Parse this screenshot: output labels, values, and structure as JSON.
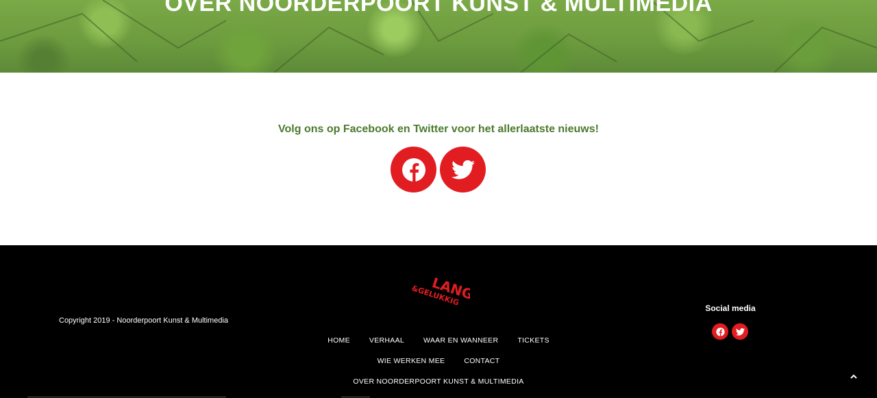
{
  "hero": {
    "title": "OVER NOORDERPOORT KUNST & MULTIMEDIA"
  },
  "follow": {
    "text": "Volg ons op Facebook en Twitter voor het allerlaatste nieuws!",
    "icons": [
      "facebook-icon",
      "twitter-icon"
    ]
  },
  "footer": {
    "copyright": "Copyright 2019 - Noorderpoort Kunst & Multimedia",
    "logo": {
      "top": "LANG",
      "bottom": "&GELUKKIG"
    },
    "nav": {
      "row1": [
        "HOME",
        "VERHAAL",
        "WAAR EN WANNEER",
        "TICKETS"
      ],
      "row2": [
        "WIE WERKEN MEE",
        "CONTACT"
      ],
      "row3": [
        "OVER NOORDERPOORT KUNST & MULTIMEDIA"
      ]
    },
    "social_label": "Social media",
    "social_icons": [
      "facebook-icon",
      "twitter-icon"
    ],
    "back_to_top_icon": "chevron-up-icon"
  },
  "colors": {
    "accent_red": "#e21d22",
    "follow_green": "#4b7a2d",
    "footer_bg": "#000000"
  }
}
